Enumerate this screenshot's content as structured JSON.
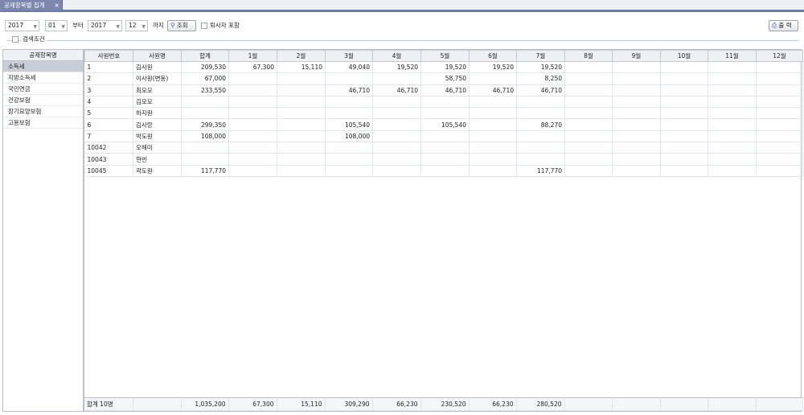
{
  "tab": {
    "title": "공제항목별 집계",
    "close": "×"
  },
  "filter": {
    "from_year": "2017",
    "from_month": "01",
    "from_label": "부터",
    "to_year": "2017",
    "to_month": "12",
    "to_label": "까지",
    "search_label": "조회",
    "include_retired_label": "퇴사자 포함",
    "print_label": "출 력",
    "conditions_label": "검색조건"
  },
  "left_panel": {
    "header": "공제항목명",
    "items": [
      "소득세",
      "지방소득세",
      "국민연금",
      "건강보험",
      "장기요양보험",
      "고용보험"
    ]
  },
  "grid": {
    "headers": [
      "사원번호",
      "사원명",
      "합계",
      "1월",
      "2월",
      "3월",
      "4월",
      "5월",
      "6월",
      "7월",
      "8월",
      "9월",
      "10월",
      "11월",
      "12월"
    ],
    "rows": [
      [
        "1",
        "김사원",
        "209,530",
        "67,300",
        "15,110",
        "49,040",
        "19,520",
        "19,520",
        "19,520",
        "19,520",
        "",
        "",
        "",
        "",
        ""
      ],
      [
        "2",
        "이사원(변동)",
        "67,000",
        "",
        "",
        "",
        "",
        "58,750",
        "",
        "8,250",
        "",
        "",
        "",
        "",
        ""
      ],
      [
        "3",
        "최모모",
        "233,550",
        "",
        "",
        "46,710",
        "46,710",
        "46,710",
        "46,710",
        "46,710",
        "",
        "",
        "",
        "",
        ""
      ],
      [
        "4",
        "김모모",
        "",
        "",
        "",
        "",
        "",
        "",
        "",
        "",
        "",
        "",
        "",
        "",
        ""
      ],
      [
        "5",
        "하지원",
        "",
        "",
        "",
        "",
        "",
        "",
        "",
        "",
        "",
        "",
        "",
        "",
        ""
      ],
      [
        "6",
        "김사랑",
        "299,350",
        "",
        "",
        "105,540",
        "",
        "105,540",
        "",
        "88,270",
        "",
        "",
        "",
        "",
        ""
      ],
      [
        "7",
        "박도원",
        "108,000",
        "",
        "",
        "108,000",
        "",
        "",
        "",
        "",
        "",
        "",
        "",
        "",
        ""
      ],
      [
        "10042",
        "오해미",
        "",
        "",
        "",
        "",
        "",
        "",
        "",
        "",
        "",
        "",
        "",
        "",
        ""
      ],
      [
        "10043",
        "현빈",
        "",
        "",
        "",
        "",
        "",
        "",
        "",
        "",
        "",
        "",
        "",
        "",
        ""
      ],
      [
        "10045",
        "곽도원",
        "117,770",
        "",
        "",
        "",
        "",
        "",
        "",
        "117,770",
        "",
        "",
        "",
        "",
        ""
      ]
    ],
    "footer": [
      "합계  10명",
      "",
      "1,035,200",
      "67,300",
      "15,110",
      "309,290",
      "66,230",
      "230,520",
      "66,230",
      "280,520",
      "",
      "",
      "",
      "",
      ""
    ]
  },
  "icons": {
    "search": "search-icon",
    "print": "printer-icon",
    "dropdown": "chevron-down-icon"
  }
}
